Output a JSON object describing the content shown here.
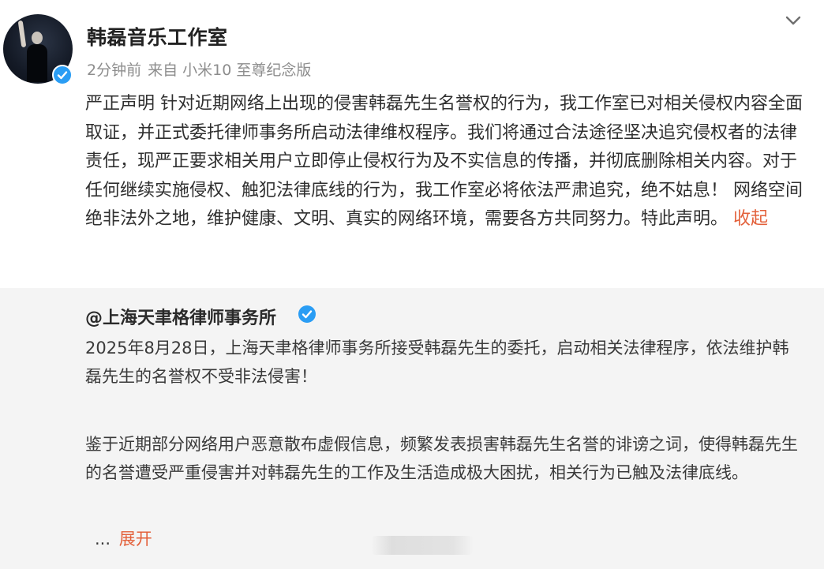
{
  "post": {
    "author_name": "韩磊音乐工作室",
    "time": "2分钟前",
    "source": "来自 小米10 至尊纪念版",
    "text": "严正声明   针对近期网络上出现的侵害韩磊先生名誉权的行为，我工作室已对相关侵权内容全面取证，并正式委托律师事务所启动法律维权程序。我们将通过合法途径坚决追究侵权者的法律责任，现严正要求相关用户立即停止侵权行为及不实信息的传播，并彻底删除相关内容。对于任何继续实施侵权、触犯法律底线的行为，我工作室必将依法严肃追究，绝不姑息！    网络空间绝非法外之地，维护健康、文明、真实的网络环境，需要各方共同努力。特此声明。",
    "collapse_label": "收起",
    "avatar_icon": "user-avatar",
    "verified_icon": "verified-badge-icon",
    "accent_color": "#e3603a",
    "badge_color": "#2a9df4"
  },
  "repost": {
    "author": "@上海天聿格律师事务所",
    "paragraph1": "2025年8月28日，上海天聿格律师事务所接受韩磊先生的委托，启动相关法律程序，依法维护韩磊先生的名誉权不受非法侵害！",
    "paragraph2": "鉴于近期部分网络用户恶意散布虚假信息，频繁发表损害韩磊先生名誉的诽谤之词，使得韩磊先生的名誉遭受严重侵害并对韩磊先生的工作及生活造成极大困扰，相关行为已触及法律底线。",
    "ellipsis": "...",
    "expand_label": "展开"
  }
}
